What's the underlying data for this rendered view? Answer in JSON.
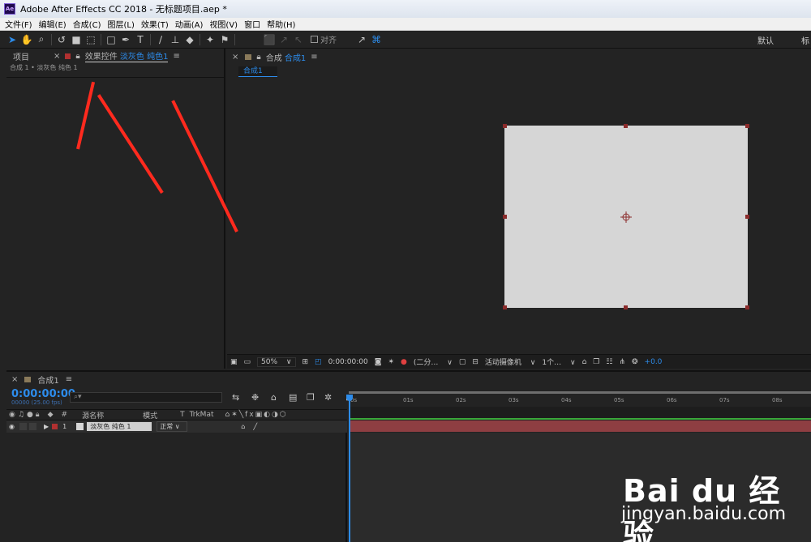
{
  "window": {
    "title": "Adobe After Effects CC 2018 - 无标题项目.aep *",
    "logo": "Ae"
  },
  "menu": [
    "文件(F)",
    "编辑(E)",
    "合成(C)",
    "图层(L)",
    "效果(T)",
    "动画(A)",
    "视图(V)",
    "窗口",
    "帮助(H)"
  ],
  "toolbar": {
    "snap_label": "对齐",
    "workspace_default": "默认",
    "workspace_standard": "标准"
  },
  "project_panel": {
    "tab_project": "项目",
    "tab_effects": "效果控件",
    "effects_target": "淡灰色 纯色1",
    "breadcrumb": "合成 1 • 淡灰色 纯色 1"
  },
  "comp_panel": {
    "tab_label": "合成",
    "tab_name": "合成1",
    "flow_tab": "合成1"
  },
  "viewer_bar": {
    "zoom": "50%",
    "timecode": "0:00:00:00",
    "resolution": "(二分…",
    "camera": "活动摄像机",
    "views": "1个…",
    "exposure": "+0.0"
  },
  "timeline": {
    "tab": "合成1",
    "timecode": "0:00:00:00",
    "fps": "00000 (25.00 fps)",
    "columns": {
      "num": "#",
      "source": "源名称",
      "mode": "模式",
      "t": "T",
      "trkmat": "TrkMat"
    },
    "layer": {
      "index": "1",
      "name": "淡灰色 纯色 1",
      "mode": "正常"
    },
    "ticks": [
      "0s",
      "01s",
      "02s",
      "03s",
      "04s",
      "05s",
      "06s",
      "07s",
      "08s"
    ]
  },
  "watermark": {
    "brand": "Bai du 经验",
    "url": "jingyan.baidu.com"
  },
  "colors": {
    "accent": "#2d8ceb",
    "layer_bar": "#8e3e42",
    "solid": "#d6d6d6",
    "arrow": "#ff2a1e"
  }
}
